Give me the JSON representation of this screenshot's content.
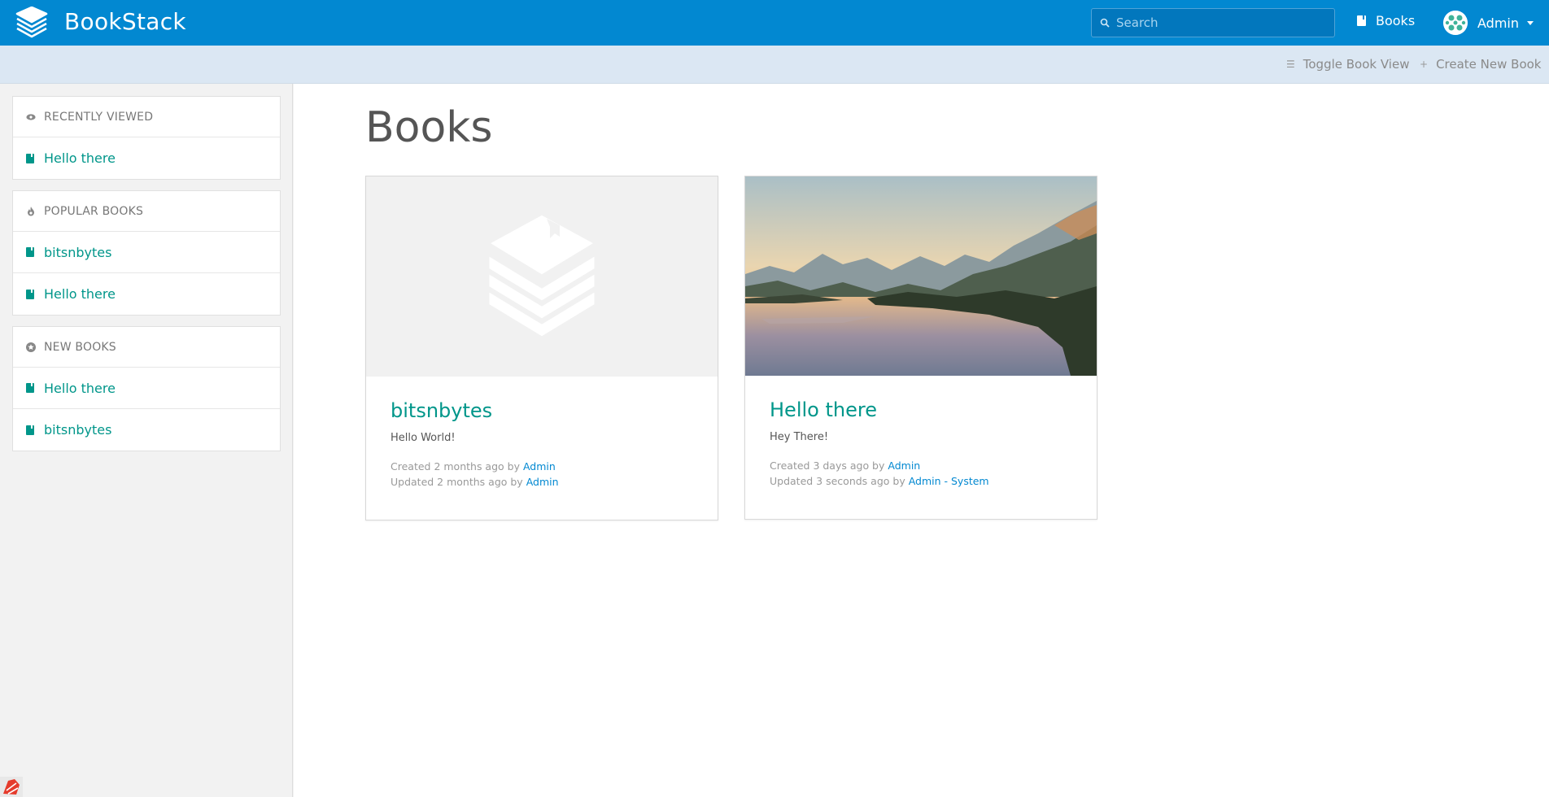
{
  "header": {
    "app_name": "BookStack",
    "search_placeholder": "Search",
    "nav_books_label": "Books",
    "user_name": "Admin"
  },
  "toolbar": {
    "toggle_view_label": "Toggle Book View",
    "create_book_label": "Create New Book"
  },
  "sidebar": {
    "recently_viewed": {
      "title": "RECENTLY VIEWED",
      "items": [
        "Hello there"
      ]
    },
    "popular_books": {
      "title": "POPULAR BOOKS",
      "items": [
        "bitsnbytes",
        "Hello there"
      ]
    },
    "new_books": {
      "title": "NEW BOOKS",
      "items": [
        "Hello there",
        "bitsnbytes"
      ]
    }
  },
  "main": {
    "page_title": "Books",
    "books": [
      {
        "name": "bitsnbytes",
        "description": "Hello World!",
        "created_prefix": "Created 2 months ago by",
        "created_by": "Admin",
        "updated_prefix": "Updated 2 months ago by",
        "updated_by": "Admin"
      },
      {
        "name": "Hello there",
        "description": "Hey There!",
        "created_prefix": "Created 3 days ago by",
        "created_by": "Admin",
        "updated_prefix": "Updated 3 seconds ago by",
        "updated_by": "Admin - System"
      }
    ]
  },
  "colors": {
    "header_bg": "#0288d1",
    "toolbar_bg": "#dbe7f3",
    "link_green": "#00968a",
    "link_blue": "#0288d1"
  },
  "icons": [
    "bookstack-logo-icon",
    "search-icon",
    "book-icon",
    "eye-icon",
    "fire-icon",
    "star-icon",
    "chevron-down-icon",
    "list-icon",
    "plus-icon"
  ]
}
